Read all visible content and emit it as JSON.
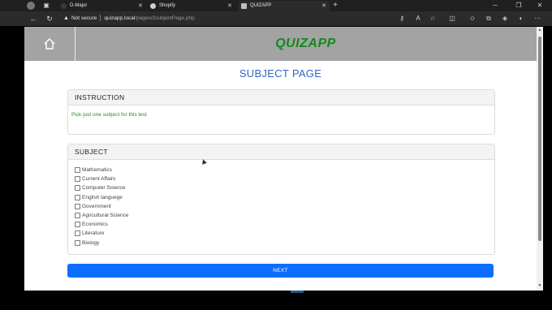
{
  "browser": {
    "tabs": [
      {
        "title": "D-Major",
        "active": false
      },
      {
        "title": "Shopify",
        "active": false
      },
      {
        "title": "QUIZAPP",
        "active": true
      }
    ],
    "new_tab": "+",
    "security_label": "Not secure",
    "url_host": "quizapp.local",
    "url_path": "/pages/2subjectPage.php"
  },
  "header": {
    "brand": "QUIZAPP"
  },
  "page": {
    "title": "SUBJECT PAGE"
  },
  "instruction": {
    "heading": "INSTRUCTION",
    "text": "Pick just one subject for this test"
  },
  "subject": {
    "heading": "SUBJECT",
    "options": [
      "Mathematics",
      "Current Affairs",
      "Computer Science",
      "English languege",
      "Government",
      "Agricultural Science",
      "Economics",
      "Literature",
      "Biology"
    ]
  },
  "actions": {
    "next_label": "NEXT"
  },
  "colors": {
    "brand": "#148a1e",
    "title": "#2f67c8",
    "button": "#0d6efd",
    "header_bg": "#a3a3a3"
  }
}
